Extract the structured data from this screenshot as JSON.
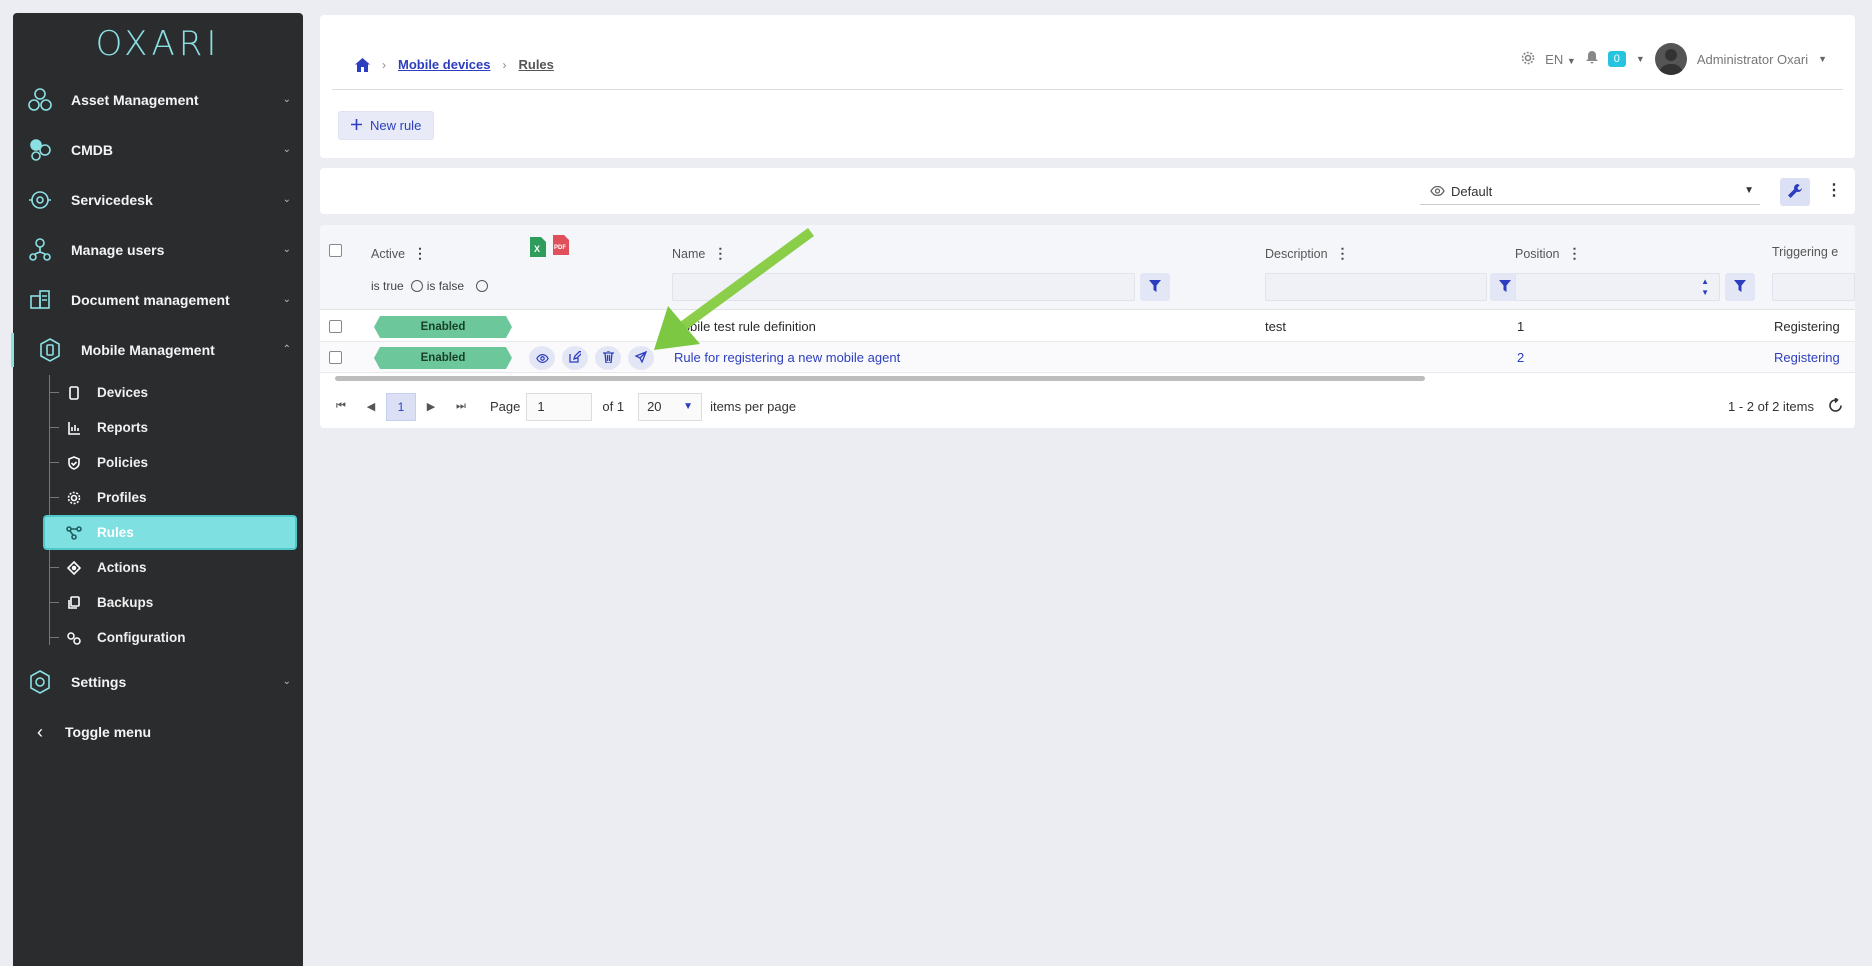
{
  "brand": {
    "logo_text": "OXARI"
  },
  "sidebar": {
    "items": [
      {
        "label": "Asset Management",
        "icon": "asset-management-icon"
      },
      {
        "label": "CMDB",
        "icon": "cmdb-icon"
      },
      {
        "label": "Servicedesk",
        "icon": "servicedesk-icon"
      },
      {
        "label": "Manage users",
        "icon": "manage-users-icon"
      },
      {
        "label": "Document management",
        "icon": "document-management-icon"
      },
      {
        "label": "Mobile Management",
        "icon": "mobile-management-icon"
      }
    ],
    "mobile_sub": [
      {
        "label": "Devices",
        "icon": "device-icon"
      },
      {
        "label": "Reports",
        "icon": "reports-icon"
      },
      {
        "label": "Policies",
        "icon": "shield-icon"
      },
      {
        "label": "Profiles",
        "icon": "gear-icon"
      },
      {
        "label": "Rules",
        "icon": "rules-icon"
      },
      {
        "label": "Actions",
        "icon": "actions-icon"
      },
      {
        "label": "Backups",
        "icon": "backups-icon"
      },
      {
        "label": "Configuration",
        "icon": "configuration-icon"
      }
    ],
    "settings_label": "Settings",
    "toggle_label": "Toggle menu"
  },
  "header": {
    "breadcrumb": {
      "parent": "Mobile devices",
      "current": "Rules"
    },
    "language": "EN",
    "notifications_count": "0",
    "user_name": "Administrator Oxari",
    "new_rule_label": "New rule"
  },
  "toolbar": {
    "view_name": "Default"
  },
  "grid": {
    "columns": {
      "active": "Active",
      "name": "Name",
      "description": "Description",
      "position": "Position",
      "triggering": "Triggering e"
    },
    "active_filter": {
      "true_label": "is true",
      "false_label": "is false"
    },
    "rows": [
      {
        "status": "Enabled",
        "name": "Mobile test rule definition",
        "description": "test",
        "position": "1",
        "triggering": "Registering"
      },
      {
        "status": "Enabled",
        "name": "Rule for registering a new mobile agent",
        "description": "",
        "position": "2",
        "triggering": "Registering"
      }
    ]
  },
  "pager": {
    "current_page": "1",
    "page_label": "Page",
    "page_input": "1",
    "of_label": "of 1",
    "per_page": "20",
    "per_page_label": "items per page",
    "summary": "1 - 2 of 2 items"
  },
  "colors": {
    "accent": "#2c3ebf",
    "sidebar_bg": "#2b2c2e",
    "teal": "#8be0e4",
    "enabled": "#6cc79a",
    "arrow": "#8fd14f"
  }
}
